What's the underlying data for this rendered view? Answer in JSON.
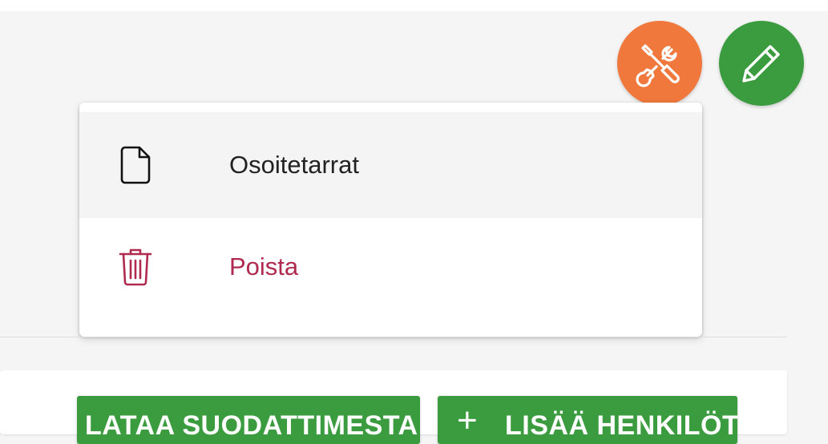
{
  "colors": {
    "tools_fab": "#f0783c",
    "edit_fab": "#3b9c3f",
    "primary_button": "#3b9c3f",
    "delete_text": "#b02a4f"
  },
  "fabs": {
    "tools_icon": "tools-icon",
    "edit_icon": "pencil-icon"
  },
  "menu": {
    "items": [
      {
        "label": "Osoitetarrat",
        "icon": "document-icon"
      },
      {
        "label": "Poista",
        "icon": "trash-icon"
      }
    ]
  },
  "actions": {
    "load_label": "LATAA SUODATTIMESTA",
    "add_icon": "+",
    "add_label": "LISÄÄ HENKILÖT"
  }
}
